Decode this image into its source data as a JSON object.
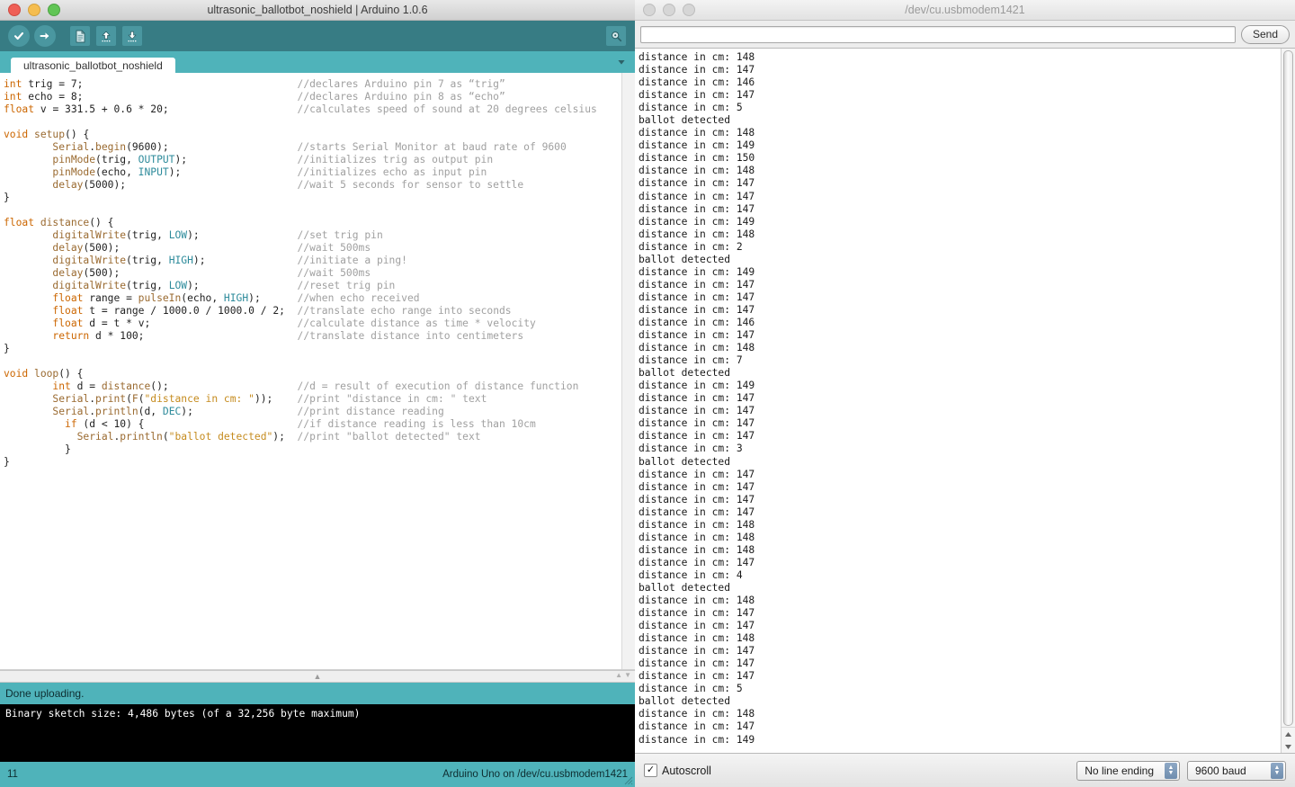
{
  "ide": {
    "window_title": "ultrasonic_ballotbot_noshield | Arduino 1.0.6",
    "toolbar": {
      "verify_label": "Verify",
      "upload_label": "Upload",
      "new_label": "New",
      "open_label": "Open",
      "save_label": "Save",
      "serial_monitor_label": "Serial Monitor"
    },
    "tab_label": "ultrasonic_ballotbot_noshield",
    "status_message": "Done uploading.",
    "console_text": "Binary sketch size: 4,486 bytes (of a 32,256 byte maximum)",
    "line_number": "11",
    "board_status": "Arduino Uno on /dev/cu.usbmodem1421",
    "colors": {
      "toolbar_bg": "#377c84",
      "tabbar_bg": "#4fb3ba",
      "status_bg": "#4fb3ba",
      "console_bg": "#000000",
      "keyword": "#cc6600",
      "function": "#9a6a30",
      "constant": "#2e8b9b",
      "string": "#c58b1e",
      "comment": "#a0a0a0"
    },
    "code_lines": [
      {
        "code": "int trig = 7;",
        "comment": "//declares Arduino pin 7 as “trig”"
      },
      {
        "code": "int echo = 8;",
        "comment": "//declares Arduino pin 8 as “echo”"
      },
      {
        "code": "float v = 331.5 + 0.6 * 20;",
        "comment": "//calculates speed of sound at 20 degrees celsius"
      },
      {
        "code": "",
        "comment": ""
      },
      {
        "code": "void setup() {",
        "comment": ""
      },
      {
        "code": "        Serial.begin(9600);",
        "comment": "//starts Serial Monitor at baud rate of 9600"
      },
      {
        "code": "        pinMode(trig, OUTPUT);",
        "comment": "//initializes trig as output pin"
      },
      {
        "code": "        pinMode(echo, INPUT);",
        "comment": "//initializes echo as input pin"
      },
      {
        "code": "        delay(5000);",
        "comment": "//wait 5 seconds for sensor to settle"
      },
      {
        "code": "}",
        "comment": ""
      },
      {
        "code": "",
        "comment": ""
      },
      {
        "code": "float distance() {",
        "comment": ""
      },
      {
        "code": "        digitalWrite(trig, LOW);",
        "comment": "//set trig pin"
      },
      {
        "code": "        delay(500);",
        "comment": "//wait 500ms"
      },
      {
        "code": "        digitalWrite(trig, HIGH);",
        "comment": "//initiate a ping!"
      },
      {
        "code": "        delay(500);",
        "comment": "//wait 500ms"
      },
      {
        "code": "        digitalWrite(trig, LOW);",
        "comment": "//reset trig pin"
      },
      {
        "code": "        float range = pulseIn(echo, HIGH);",
        "comment": "//when echo received"
      },
      {
        "code": "        float t = range / 1000.0 / 1000.0 / 2;",
        "comment": "//translate echo range into seconds"
      },
      {
        "code": "        float d = t * v;",
        "comment": "//calculate distance as time * velocity"
      },
      {
        "code": "        return d * 100;",
        "comment": "//translate distance into centimeters"
      },
      {
        "code": "}",
        "comment": ""
      },
      {
        "code": "",
        "comment": ""
      },
      {
        "code": "void loop() {",
        "comment": ""
      },
      {
        "code": "        int d = distance();",
        "comment": "//d = result of execution of distance function"
      },
      {
        "code": "        Serial.print(F(\"distance in cm: \"));",
        "comment": "//print \"distance in cm: \" text"
      },
      {
        "code": "        Serial.println(d, DEC);",
        "comment": "//print distance reading"
      },
      {
        "code": "          if (d < 10) {",
        "comment": "//if distance reading is less than 10cm"
      },
      {
        "code": "            Serial.println(\"ballot detected\");",
        "comment": "//print \"ballot detected\" text"
      },
      {
        "code": "          }",
        "comment": ""
      },
      {
        "code": "}",
        "comment": ""
      }
    ]
  },
  "serial_monitor": {
    "window_title": "/dev/cu.usbmodem1421",
    "send_input_value": "",
    "send_input_placeholder": "",
    "send_button_label": "Send",
    "autoscroll_label": "Autoscroll",
    "autoscroll_checked": true,
    "checkmark": "✓",
    "line_ending_value": "No line ending",
    "baud_rate_value": "9600 baud",
    "output_lines": [
      "distance in cm: 148",
      "distance in cm: 147",
      "distance in cm: 146",
      "distance in cm: 147",
      "distance in cm: 5",
      "ballot detected",
      "distance in cm: 148",
      "distance in cm: 149",
      "distance in cm: 150",
      "distance in cm: 148",
      "distance in cm: 147",
      "distance in cm: 147",
      "distance in cm: 147",
      "distance in cm: 149",
      "distance in cm: 148",
      "distance in cm: 2",
      "ballot detected",
      "distance in cm: 149",
      "distance in cm: 147",
      "distance in cm: 147",
      "distance in cm: 147",
      "distance in cm: 146",
      "distance in cm: 147",
      "distance in cm: 148",
      "distance in cm: 7",
      "ballot detected",
      "distance in cm: 149",
      "distance in cm: 147",
      "distance in cm: 147",
      "distance in cm: 147",
      "distance in cm: 147",
      "distance in cm: 3",
      "ballot detected",
      "distance in cm: 147",
      "distance in cm: 147",
      "distance in cm: 147",
      "distance in cm: 147",
      "distance in cm: 148",
      "distance in cm: 148",
      "distance in cm: 148",
      "distance in cm: 147",
      "distance in cm: 4",
      "ballot detected",
      "distance in cm: 148",
      "distance in cm: 147",
      "distance in cm: 147",
      "distance in cm: 148",
      "distance in cm: 147",
      "distance in cm: 147",
      "distance in cm: 147",
      "distance in cm: 5",
      "ballot detected",
      "distance in cm: 148",
      "distance in cm: 147",
      "distance in cm: 149"
    ]
  }
}
